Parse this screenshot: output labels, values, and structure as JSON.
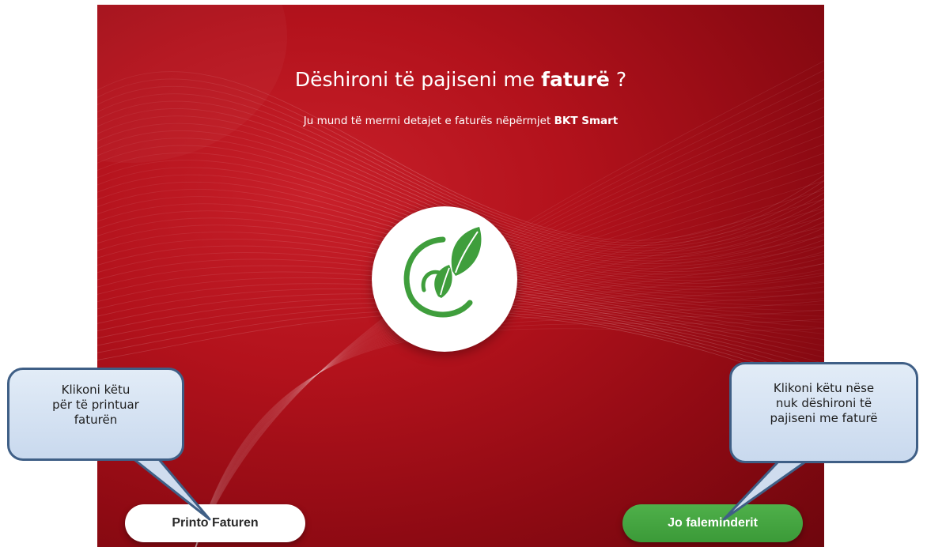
{
  "screen": {
    "title_prefix": "Dëshironi të pajiseni me",
    "title_bold": "faturë",
    "title_suffix": "?",
    "subtitle_prefix": "Ju mund të merrni detajet e faturës nëpërmjet",
    "subtitle_bold": "BKT Smart",
    "logo_icon": "leaf-swirl-icon",
    "colors": {
      "background": "#b3121c",
      "accent_green": "#3f9e3c",
      "callout_border": "#3f5f86"
    }
  },
  "buttons": {
    "print_label": "Printo Faturen",
    "no_label": "Jo faleminderit"
  },
  "callouts": {
    "left_lines": [
      "Klikoni këtu",
      "për të printuar",
      "faturën"
    ],
    "right_lines": [
      "Klikoni këtu nëse",
      "nuk dëshironi të",
      "pajiseni me faturë"
    ]
  }
}
